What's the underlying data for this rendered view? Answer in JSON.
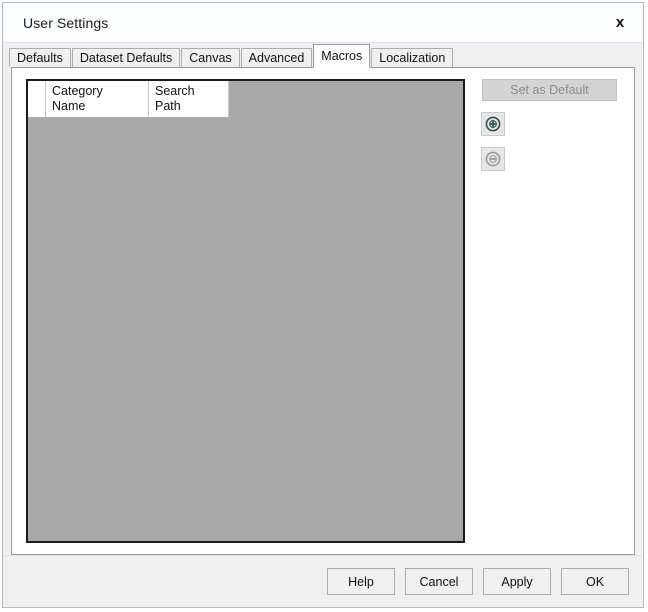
{
  "window": {
    "title": "User Settings",
    "close_label": "✕"
  },
  "tabs": [
    {
      "label": "Defaults",
      "active": false
    },
    {
      "label": "Dataset Defaults",
      "active": false
    },
    {
      "label": "Canvas",
      "active": false
    },
    {
      "label": "Advanced",
      "active": false
    },
    {
      "label": "Macros",
      "active": true
    },
    {
      "label": "Localization",
      "active": false
    }
  ],
  "macros_panel": {
    "grid": {
      "columns": [
        {
          "header": "Category\nName"
        },
        {
          "header": "Search\nPath"
        }
      ],
      "rows": []
    },
    "set_as_default_label": "Set as Default",
    "add_icon": "plus-circle-icon",
    "remove_icon": "minus-circle-icon"
  },
  "footer": {
    "help_label": "Help",
    "cancel_label": "Cancel",
    "apply_label": "Apply",
    "ok_label": "OK"
  },
  "colors": {
    "dialog_bg": "#f0f0f0",
    "panel_bg": "#ffffff",
    "grid_bg": "#a8a8a8",
    "grid_border": "#1a1a1a",
    "titlebar_bg": "#fbfdff",
    "disabled_text": "#8b8b8b",
    "icon_enabled": "#2e4f4f",
    "icon_disabled": "#9a9a9a"
  }
}
